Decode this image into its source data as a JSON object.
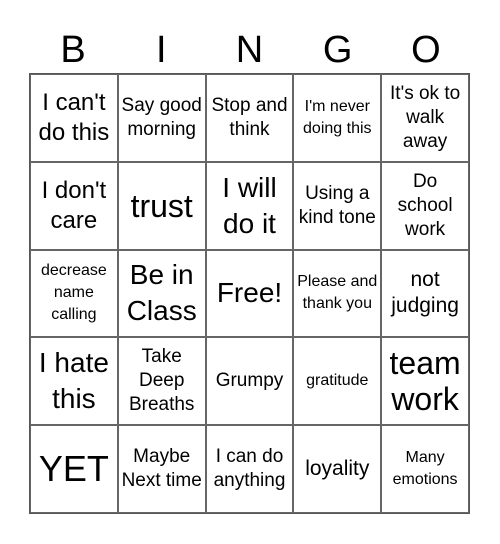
{
  "header": [
    "B",
    "I",
    "N",
    "G",
    "O"
  ],
  "cells": [
    {
      "text": "I can't do this",
      "size": "s24"
    },
    {
      "text": "Say good morning",
      "size": "s18"
    },
    {
      "text": "Stop and think",
      "size": "s18"
    },
    {
      "text": "I'm never doing this",
      "size": "s16"
    },
    {
      "text": "It's ok to walk away",
      "size": "s18"
    },
    {
      "text": "I don't care",
      "size": "s24"
    },
    {
      "text": "trust",
      "size": "s30"
    },
    {
      "text": "I will do it",
      "size": "s27"
    },
    {
      "text": "Using a kind tone",
      "size": "s18"
    },
    {
      "text": "Do school work",
      "size": "s18"
    },
    {
      "text": "decrease name calling",
      "size": "s16"
    },
    {
      "text": "Be in Class",
      "size": "s27"
    },
    {
      "text": "Free!",
      "size": "s27"
    },
    {
      "text": "Please and thank you",
      "size": "s16"
    },
    {
      "text": "not judging",
      "size": "s21"
    },
    {
      "text": "I hate this",
      "size": "s27"
    },
    {
      "text": "Take Deep Breaths",
      "size": "s18"
    },
    {
      "text": "Grumpy",
      "size": "s18"
    },
    {
      "text": "gratitude",
      "size": "s16"
    },
    {
      "text": "team work",
      "size": "s30"
    },
    {
      "text": "YET",
      "size": "s36"
    },
    {
      "text": "Maybe Next time",
      "size": "s18"
    },
    {
      "text": "I can do anything",
      "size": "s18"
    },
    {
      "text": "loyality",
      "size": "s21"
    },
    {
      "text": "Many emotions",
      "size": "s16"
    }
  ]
}
